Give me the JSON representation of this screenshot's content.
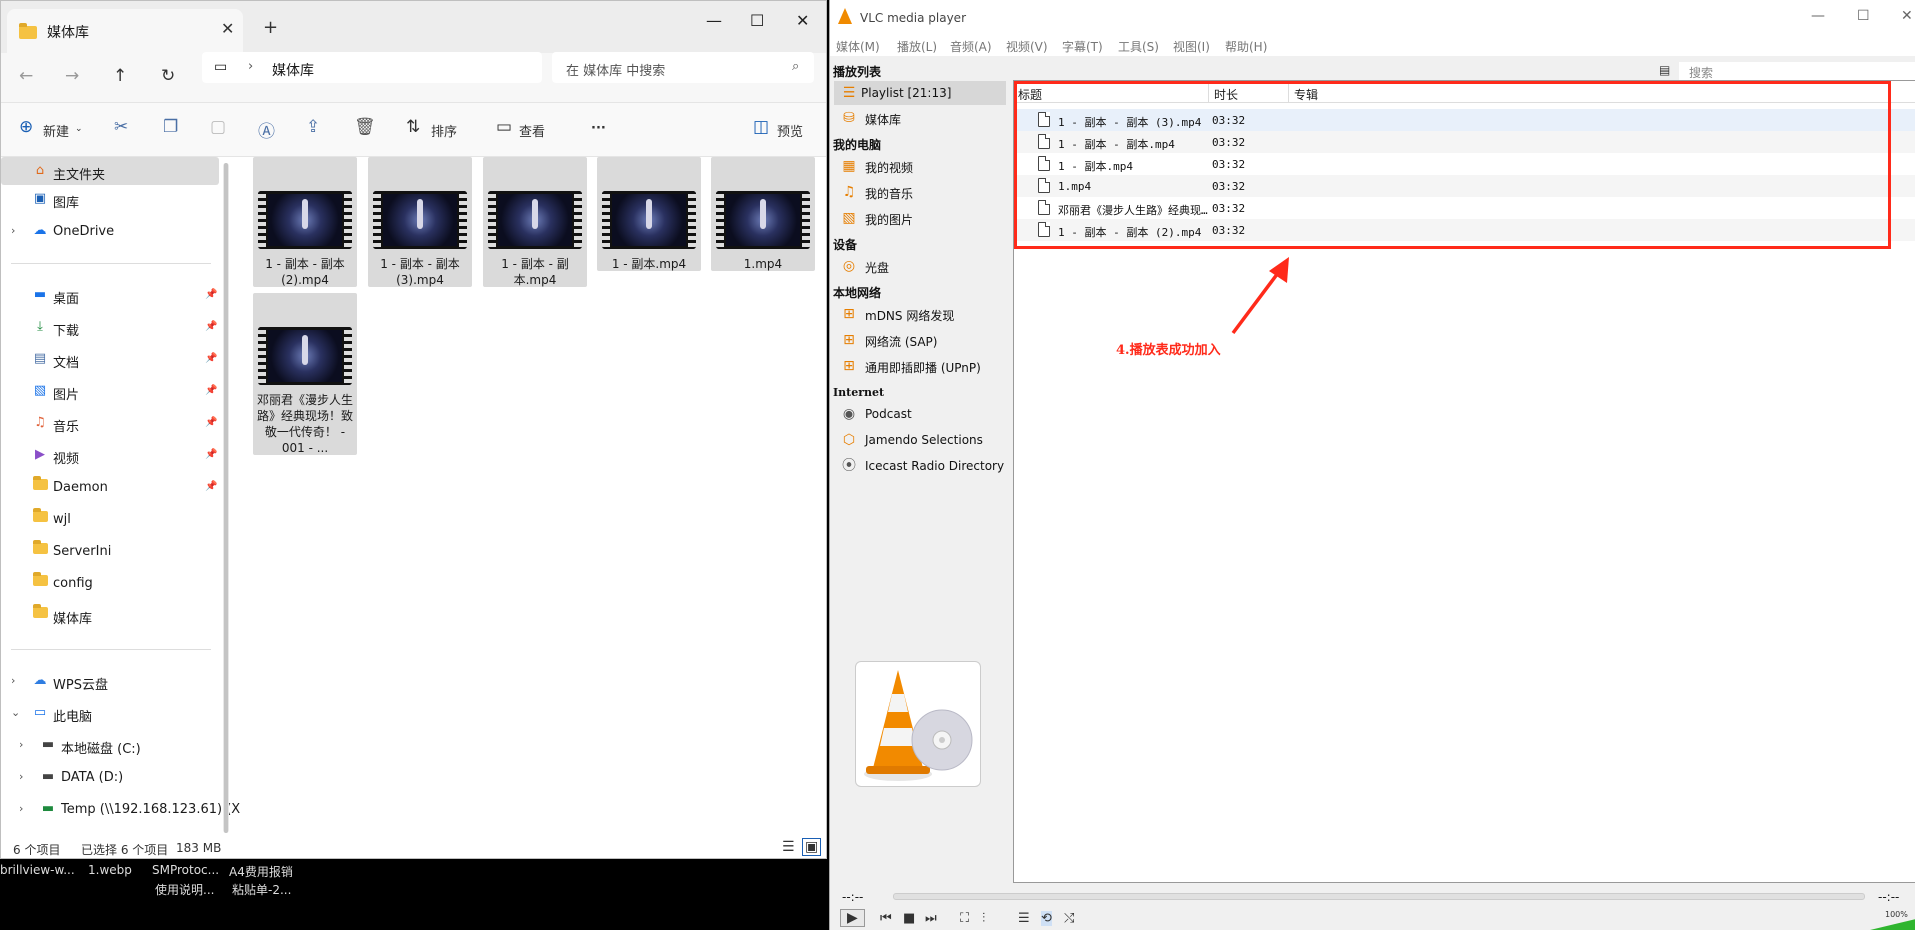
{
  "explorer": {
    "tab_title": "媒体库",
    "path": "媒体库",
    "search_placeholder": "在 媒体库 中搜索",
    "toolbar": {
      "new_label": "新建",
      "sort_label": "排序",
      "view_label": "查看",
      "more_label": "···",
      "preview_label": "预览"
    },
    "sidebar": {
      "home": "主文件夹",
      "gallery": "图库",
      "onedrive": "OneDrive",
      "quick": [
        "桌面",
        "下载",
        "文档",
        "图片",
        "音乐",
        "视频",
        "Daemon",
        "wjl",
        "ServerIni",
        "config",
        "媒体库"
      ],
      "wps": "WPS云盘",
      "thispc": "此电脑",
      "drives": [
        "本地磁盘 (C:)",
        "DATA (D:)",
        "Temp (\\\\192.168.123.61) (X"
      ]
    },
    "files": [
      {
        "name": "1 - 副本 - 副本 (2).mp4"
      },
      {
        "name": "1 - 副本 - 副本 (3).mp4"
      },
      {
        "name": "1 - 副本 - 副本.mp4"
      },
      {
        "name": "1 - 副本.mp4"
      },
      {
        "name": "1.mp4"
      },
      {
        "name": "邓丽君《漫步人生路》经典现场！致敬一代传奇！ - 001 - ..."
      }
    ],
    "status": {
      "count": "6 个项目",
      "selected": "已选择 6 个项目",
      "size": "183 MB"
    }
  },
  "taskbar": {
    "items": [
      "brillview-w...",
      "1.webp",
      "SMProtoc...",
      "A4费用报销",
      "使用说明...",
      "粘贴单-2..."
    ]
  },
  "vlc": {
    "title": "VLC media player",
    "menu": [
      "媒体(M)",
      "播放(L)",
      "音频(A)",
      "视频(V)",
      "字幕(T)",
      "工具(S)",
      "视图(I)",
      "帮助(H)"
    ],
    "search_placeholder": "搜索",
    "sections": {
      "playlist": "播放列表",
      "mypc": "我的电脑",
      "devices": "设备",
      "lan": "本地网络",
      "internet": "Internet"
    },
    "items": {
      "playlist": "Playlist [21:13]",
      "medialib": "媒体库",
      "videos": "我的视频",
      "music": "我的音乐",
      "pictures": "我的图片",
      "disc": "光盘",
      "mdns": "mDNS 网络发现",
      "sap": "网络流 (SAP)",
      "upnp": "通用即插即播 (UPnP)",
      "podcast": "Podcast",
      "jamendo": "Jamendo Selections",
      "icecast": "Icecast Radio Directory"
    },
    "columns": {
      "title": "标题",
      "duration": "时长",
      "album": "专辑"
    },
    "rows": [
      {
        "title": "1 - 副本 - 副本 (3).mp4",
        "duration": "03:32"
      },
      {
        "title": "1 - 副本 - 副本.mp4",
        "duration": "03:32"
      },
      {
        "title": "1 - 副本.mp4",
        "duration": "03:32"
      },
      {
        "title": "1.mp4",
        "duration": "03:32"
      },
      {
        "title": "邓丽君《漫步人生路》经典现场！致敬一代传奇！",
        "duration": "03:32"
      },
      {
        "title": "1 - 副本 - 副本 (2).mp4",
        "duration": "03:32"
      }
    ],
    "time_left": "--:--",
    "time_right": "--:--",
    "volume": "100%"
  },
  "annotation": {
    "text": "4.播放表成功加入",
    "color": "#ff2a1a"
  }
}
